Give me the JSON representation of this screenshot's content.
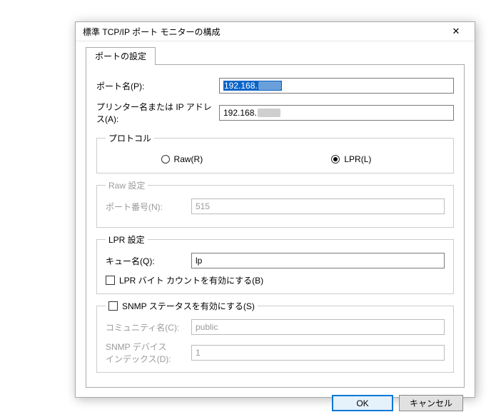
{
  "window": {
    "title": "標準 TCP/IP ポート モニターの構成"
  },
  "tab": {
    "label": "ポートの設定"
  },
  "fields": {
    "port_name_label": "ポート名(P):",
    "port_name_value_prefix": "192.168.",
    "printer_label": "プリンター名または IP アドレス(A):",
    "printer_value_prefix": "192.168."
  },
  "protocol": {
    "legend": "プロトコル",
    "raw_label": "Raw(R)",
    "lpr_label": "LPR(L)",
    "selected": "lpr"
  },
  "raw": {
    "legend": "Raw 設定",
    "port_number_label": "ポート番号(N):",
    "port_number_value": "515"
  },
  "lpr": {
    "legend": "LPR 設定",
    "queue_label": "キュー名(Q):",
    "queue_value": "lp",
    "bytecount_label": "LPR バイト カウントを有効にする(B)"
  },
  "snmp": {
    "enable_label": "SNMP ステータスを有効にする(S)",
    "community_label": "コミュニティ名(C):",
    "community_value": "public",
    "index_label_line1": "SNMP デバイス",
    "index_label_line2": "インデックス(D):",
    "index_value": "1"
  },
  "buttons": {
    "ok": "OK",
    "cancel": "キャンセル"
  }
}
